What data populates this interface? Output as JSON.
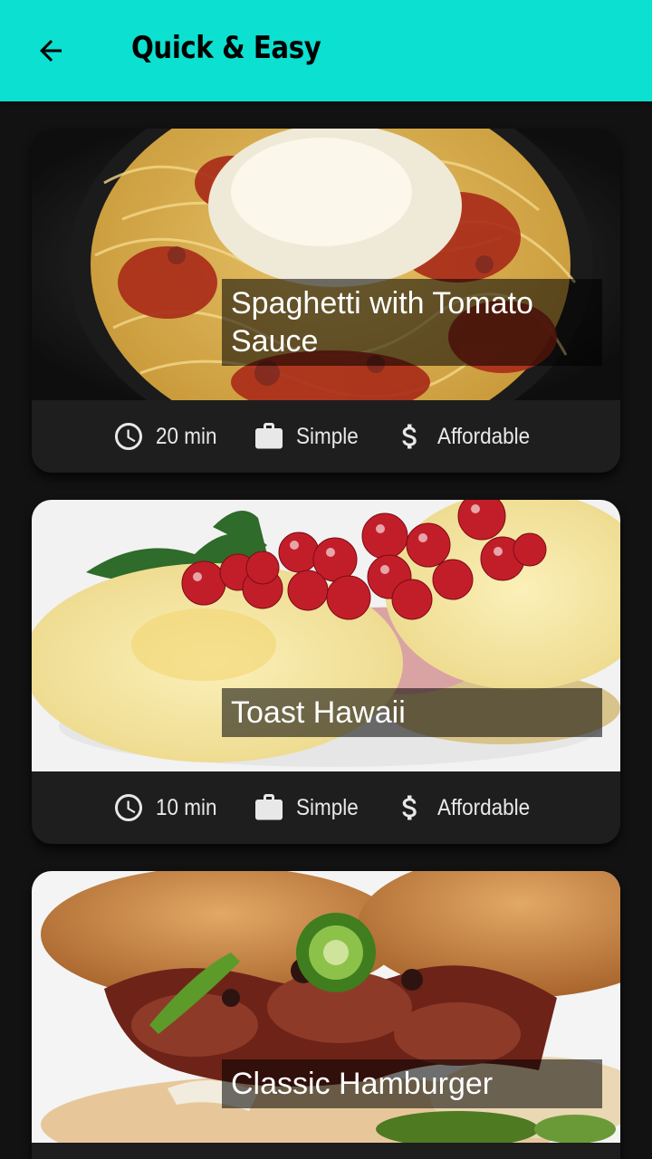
{
  "appbar": {
    "title": "Quick & Easy",
    "back_icon": "arrow-back-icon",
    "background": "#0ce0d0"
  },
  "meals": [
    {
      "title": "Spaghetti with Tomato Sauce",
      "duration": "20 min",
      "complexity": "Simple",
      "affordability": "Affordable",
      "image": "spaghetti-photo"
    },
    {
      "title": "Toast Hawaii",
      "duration": "10 min",
      "complexity": "Simple",
      "affordability": "Affordable",
      "image": "toast-hawaii-photo"
    },
    {
      "title": "Classic Hamburger",
      "image": "hamburger-photo"
    }
  ],
  "icons": {
    "duration": "schedule-icon",
    "complexity": "work-icon",
    "affordability": "attach-money-icon"
  }
}
